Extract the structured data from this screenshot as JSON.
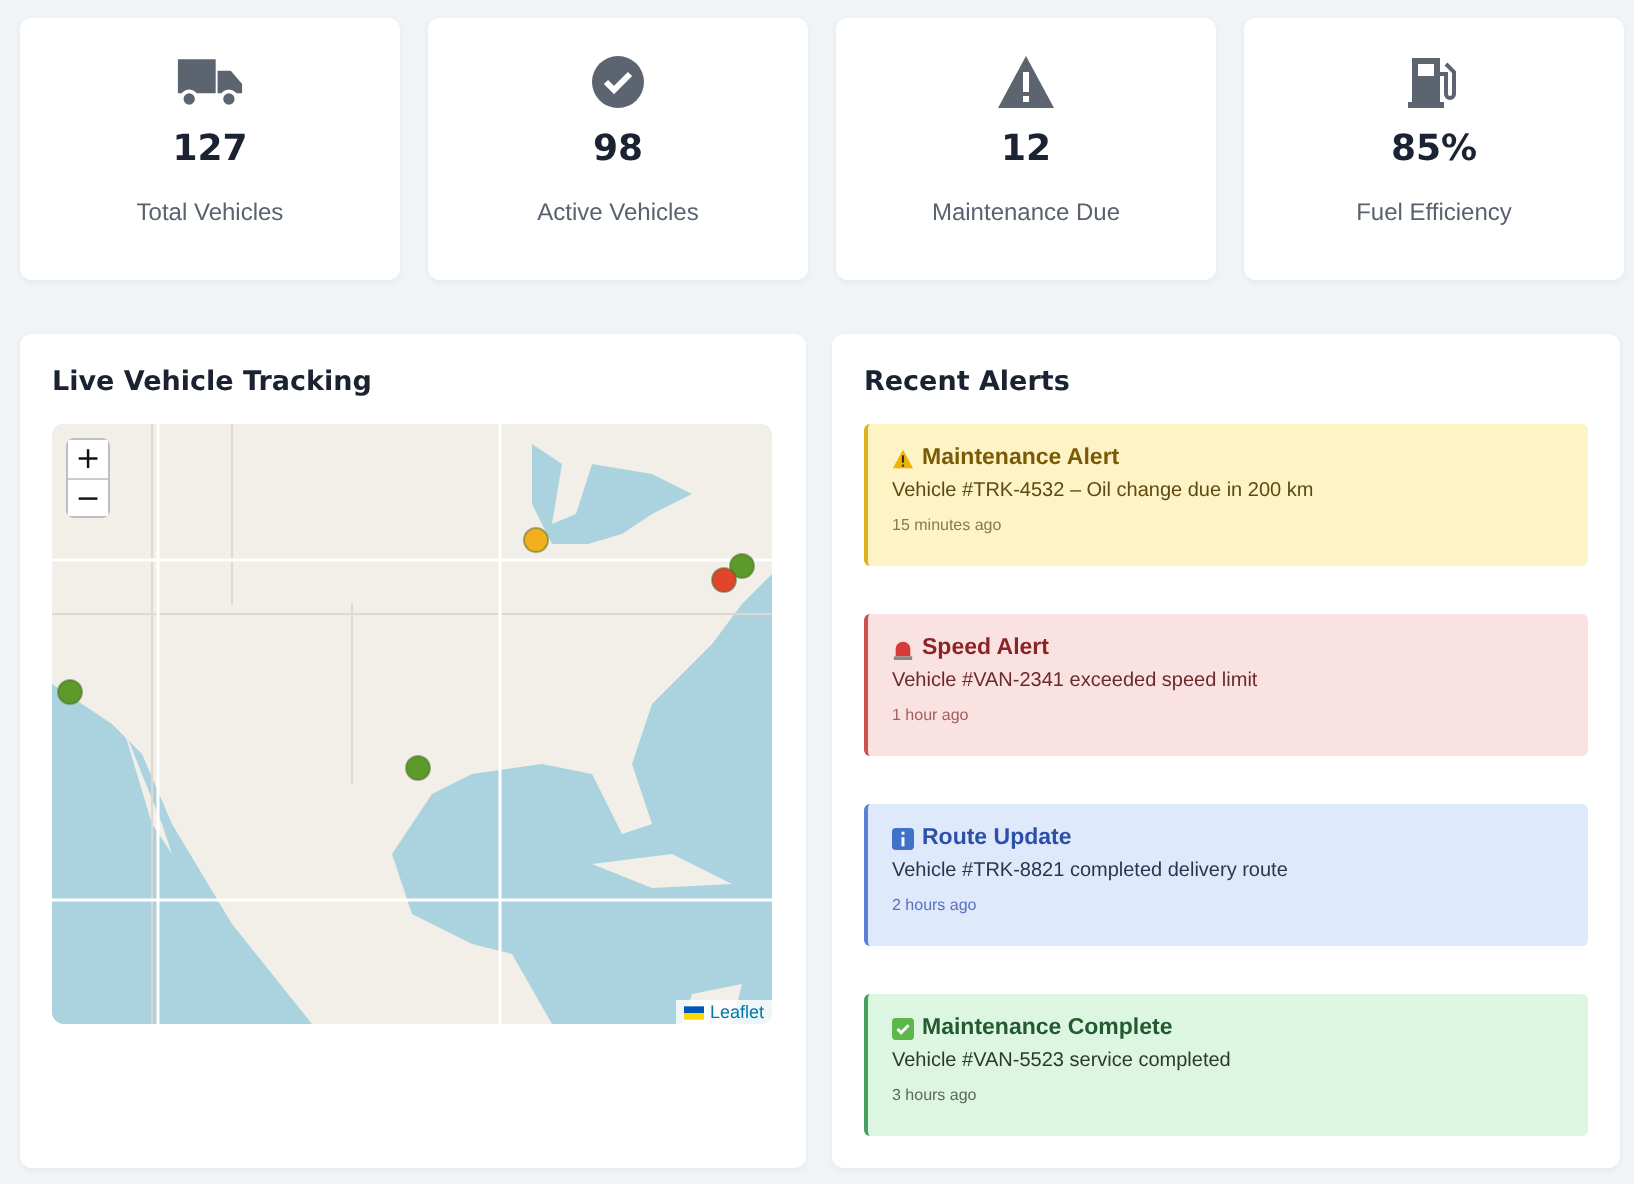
{
  "stats": [
    {
      "kind": "truck",
      "value": "127",
      "label": "Total Vehicles"
    },
    {
      "kind": "check",
      "value": "98",
      "label": "Active Vehicles"
    },
    {
      "kind": "warning",
      "value": "12",
      "label": "Maintenance Due"
    },
    {
      "kind": "fuel",
      "value": "85%",
      "label": "Fuel Efficiency"
    }
  ],
  "tracking": {
    "title": "Live Vehicle Tracking",
    "zoom_in": "+",
    "zoom_out": "−",
    "attribution": "Leaflet",
    "markers": [
      {
        "color": "#f2b01e"
      },
      {
        "color": "#5c9a2a"
      },
      {
        "color": "#e2452b"
      },
      {
        "color": "#5c9a2a"
      },
      {
        "color": "#5c9a2a"
      }
    ]
  },
  "alerts": {
    "title": "Recent Alerts",
    "items": [
      {
        "kind": "warning",
        "title": "Maintenance Alert",
        "message": "Vehicle #TRK-4532 – Oil change due in 200 km",
        "time": "15 minutes ago"
      },
      {
        "kind": "danger",
        "title": "Speed Alert",
        "message": "Vehicle #VAN-2341 exceeded speed limit",
        "time": "1 hour ago"
      },
      {
        "kind": "info",
        "title": "Route Update",
        "message": "Vehicle #TRK-8821 completed delivery route",
        "time": "2 hours ago"
      },
      {
        "kind": "success",
        "title": "Maintenance Complete",
        "message": "Vehicle #VAN-5523 service completed",
        "time": "3 hours ago"
      }
    ]
  }
}
